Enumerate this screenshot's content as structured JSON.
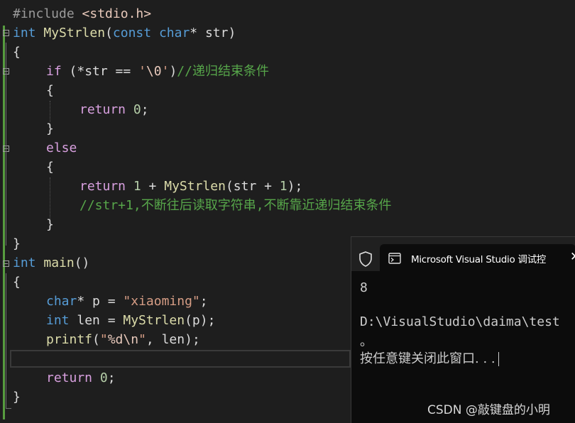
{
  "code": {
    "l1": {
      "a": "#include ",
      "b": "<stdio.h>"
    },
    "l2": {
      "kw1": "int",
      "fn": "MyStrlen",
      "p1": "(",
      "kw2": "const",
      "sp": " ",
      "kw3": "char",
      "rest": "* str)"
    },
    "l3": "{",
    "l4": {
      "ctl": "if",
      "a": " (*str == ",
      "s1": "'",
      "esc": "\\0",
      "s2": "'",
      "b": ")",
      "cm": "//递归结束条件"
    },
    "l5": "{",
    "l6": {
      "ctl": "return",
      "sp": " ",
      "num": "0",
      "end": ";"
    },
    "l7": "}",
    "l8": {
      "ctl": "else"
    },
    "l9": "{",
    "l10": {
      "ctl": "return",
      "a": " ",
      "n1": "1",
      "b": " + ",
      "fn": "MyStrlen",
      "c": "(str + ",
      "n2": "1",
      "d": ");"
    },
    "l11": {
      "cm": "//str+1,不断往后读取字符串,不断靠近递归结束条件"
    },
    "l12": "}",
    "l13": "}",
    "l14": {
      "kw": "int",
      "sp": " ",
      "fn": "main",
      "rest": "()"
    },
    "l15": "{",
    "l16": {
      "kw": "char",
      "a": "* p = ",
      "str": "\"xiaoming\"",
      "end": ";"
    },
    "l17": {
      "kw": "int",
      "a": " len = ",
      "fn": "MyStrlen",
      "b": "(p);"
    },
    "l18": {
      "fn": "printf",
      "a": "(",
      "s1": "\"",
      "esc1": "%d\\n",
      "s2": "\"",
      "b": ", len);"
    },
    "l20": {
      "ctl": "return",
      "sp": " ",
      "num": "0",
      "end": ";"
    },
    "l21": "}"
  },
  "console": {
    "title": "Microsoft Visual Studio 调试控",
    "close": "✕",
    "shield_icon": "shield-icon",
    "terminal_icon": "terminal-icon",
    "output_line1": "8",
    "output_line2": "D:\\VisualStudio\\daima\\test",
    "output_line3": "。",
    "output_line4": "按任意键关闭此窗口. . ."
  },
  "watermark": "CSDN @敲键盘的小明",
  "colors": {
    "background": "#1e1e1e",
    "keyword": "#569cd6",
    "control": "#d8a0df",
    "function": "#dcdcaa",
    "string": "#d69d85",
    "number": "#b5cea8",
    "comment": "#57a64a",
    "console_bg": "#0c0c0c"
  }
}
